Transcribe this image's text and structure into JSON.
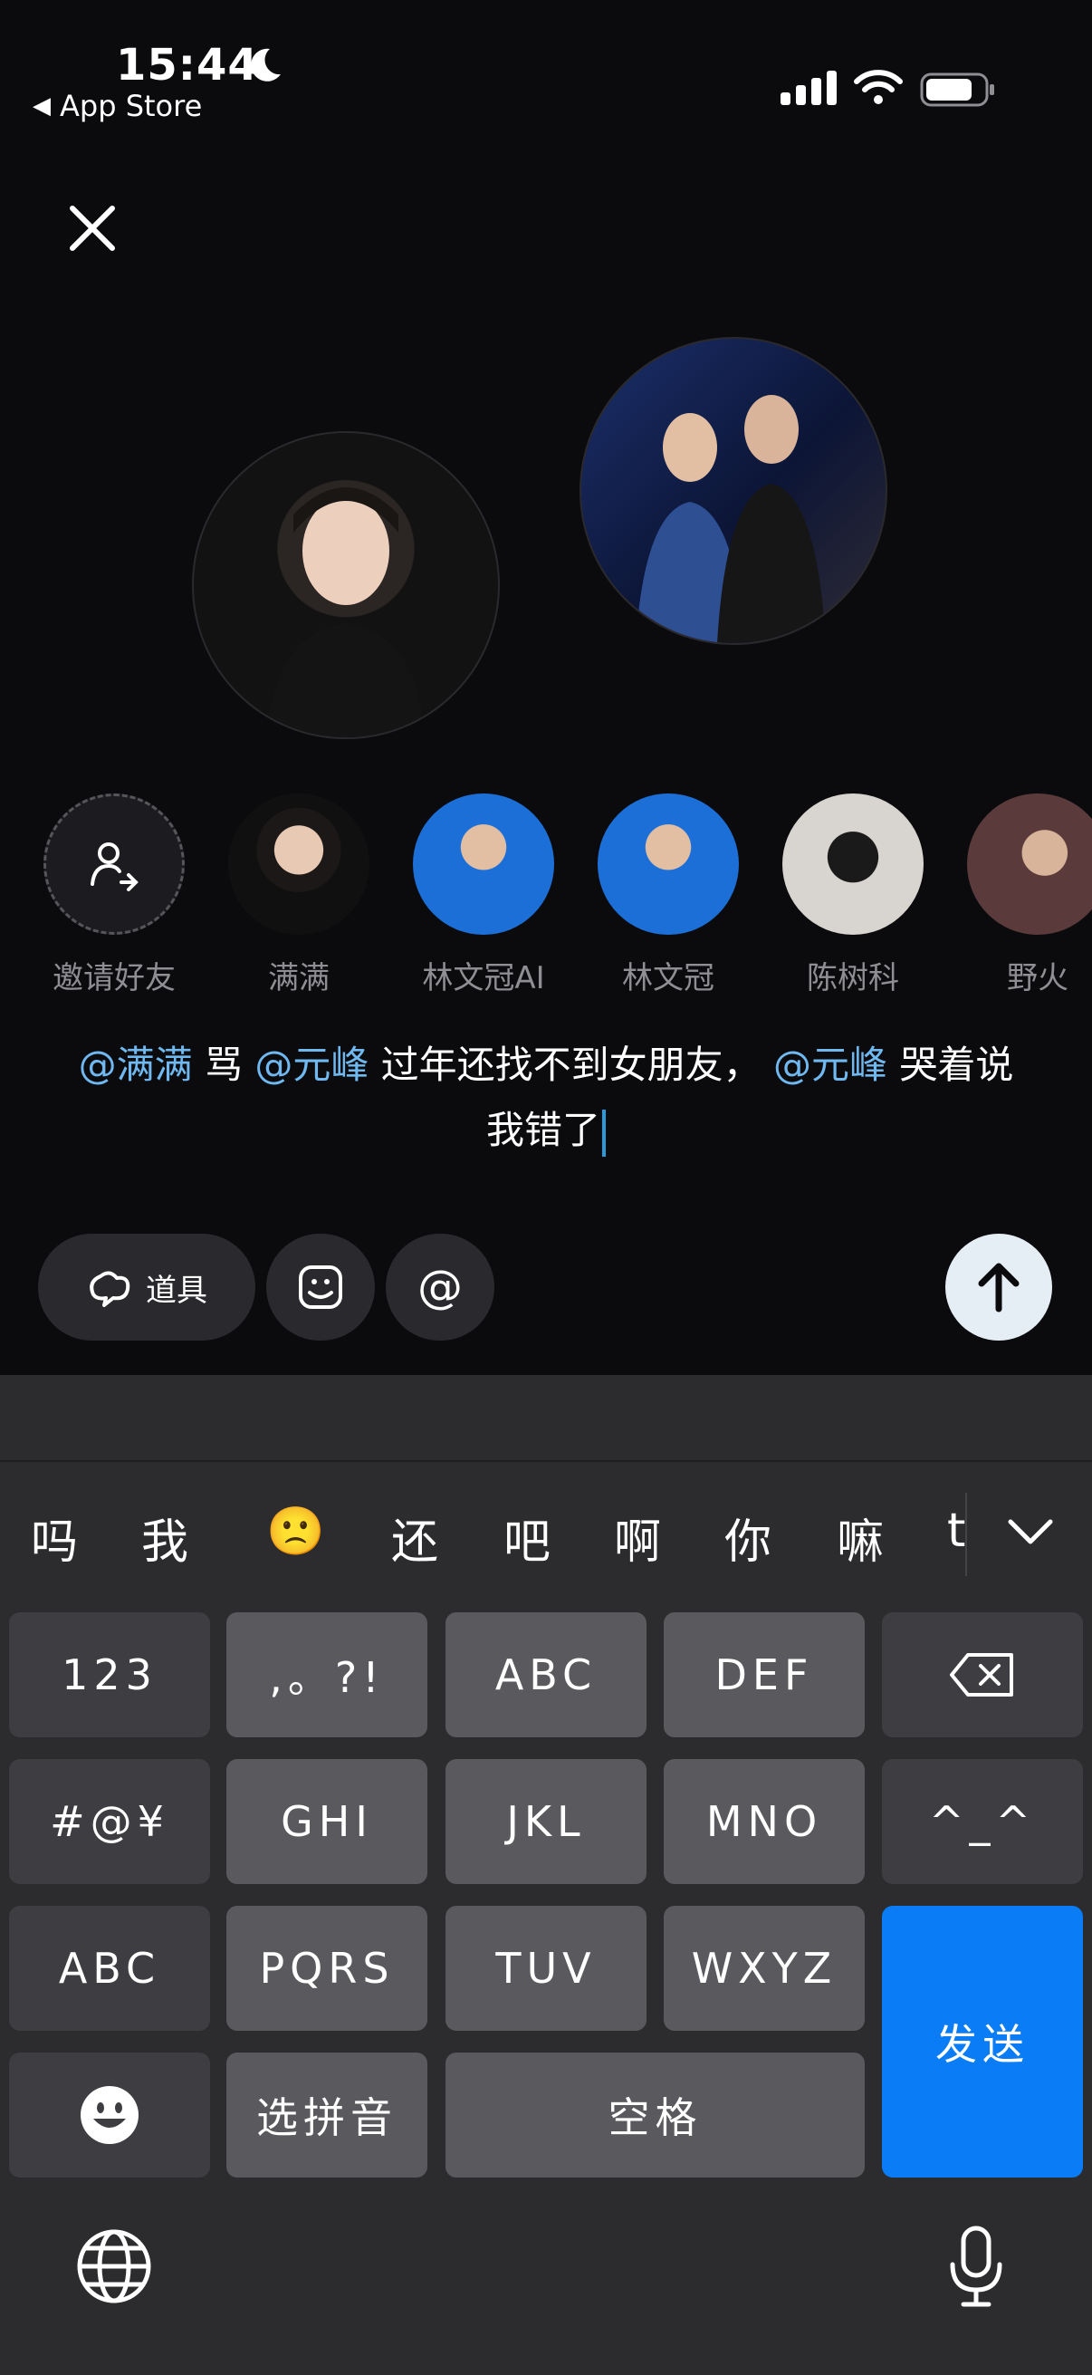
{
  "status": {
    "time": "15:44",
    "back_label": "App Store"
  },
  "friends": [
    {
      "name": "邀请好友"
    },
    {
      "name": "满满"
    },
    {
      "name": "林文冠AI"
    },
    {
      "name": "林文冠"
    },
    {
      "name": "陈树科"
    },
    {
      "name": "野火"
    }
  ],
  "message": {
    "mention1": "@满满",
    "text1": " 骂 ",
    "mention2": "@元峰",
    "text2": " 过年还找不到女朋友， ",
    "mention3": "@元峰",
    "text3": " 哭着说 我错了"
  },
  "toolbar": {
    "props_label": "道具",
    "at_label": "@"
  },
  "keyboard": {
    "candidates": [
      "吗",
      "我",
      "🙁",
      "还",
      "吧",
      "啊",
      "你",
      "嘛",
      "t"
    ],
    "rows": [
      [
        "123",
        ",。?!",
        "ABC",
        "DEF"
      ],
      [
        "#@¥",
        "GHI",
        "JKL",
        "MNO",
        "^_^"
      ],
      [
        "ABC",
        "PQRS",
        "TUV",
        "WXYZ"
      ],
      [
        "选拼音",
        "空格"
      ]
    ],
    "send_label": "发送"
  }
}
